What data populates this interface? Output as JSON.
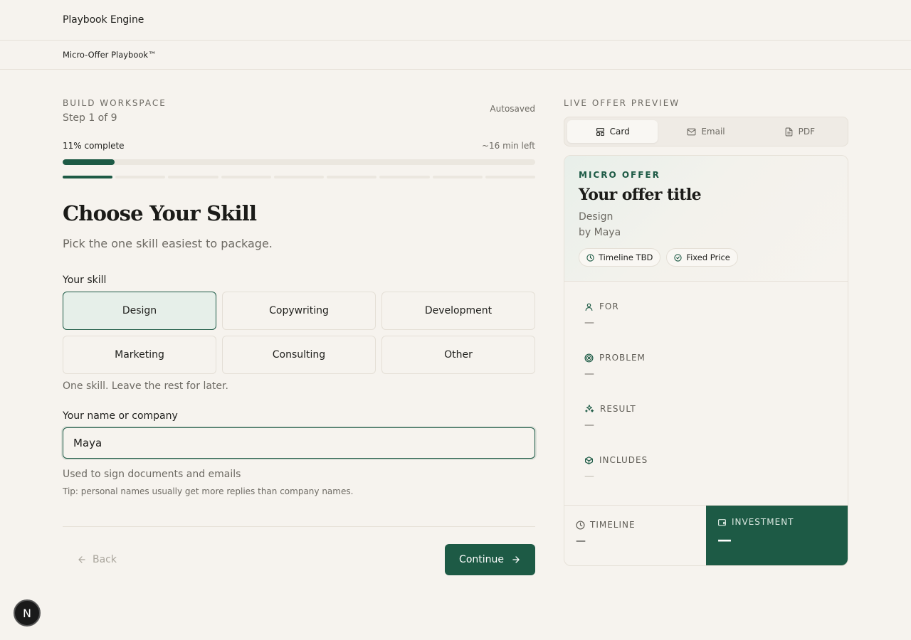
{
  "app": {
    "brand": "Playbook Engine",
    "breadcrumb": "Micro-Offer Playbook™"
  },
  "workspace": {
    "eyebrow": "BUILD WORKSPACE",
    "step": "Step 1 of 9",
    "autosave": "Autosaved",
    "progress_text": "11% complete",
    "time_left": "~16 min left",
    "progress": 0.11,
    "steps_total": 9,
    "steps_done": 1
  },
  "form": {
    "title": "Choose Your Skill",
    "subtitle": "Pick the one skill easiest to package.",
    "skill_label": "Your skill",
    "skills": [
      "Design",
      "Copywriting",
      "Development",
      "Marketing",
      "Consulting",
      "Other"
    ],
    "selected_skill": "Design",
    "skill_hint": "One skill. Leave the rest for later.",
    "name_label": "Your name or company",
    "name_value": "Maya",
    "name_help": "Used to sign documents and emails",
    "name_tip": "Tip: personal names usually get more replies than company names.",
    "back_label": "Back",
    "continue_label": "Continue"
  },
  "preview": {
    "eyebrow": "LIVE OFFER PREVIEW",
    "tabs": [
      {
        "label": "Card",
        "icon": "card-layout-icon"
      },
      {
        "label": "Email",
        "icon": "mail-icon"
      },
      {
        "label": "PDF",
        "icon": "document-icon"
      }
    ],
    "card": {
      "eyebrow": "MICRO OFFER",
      "title": "Your offer title",
      "skill": "Design",
      "byline": "by Maya",
      "chips": [
        "Timeline TBD",
        "Fixed Price"
      ],
      "sections": [
        {
          "label": "FOR",
          "value": "—",
          "icon": "user-icon"
        },
        {
          "label": "PROBLEM",
          "value": "—",
          "icon": "target-icon"
        },
        {
          "label": "RESULT",
          "value": "—",
          "icon": "sparkles-icon"
        },
        {
          "label": "INCLUDES",
          "value": "—",
          "icon": "package-icon"
        }
      ],
      "timeline_label": "TIMELINE",
      "timeline_value": "—",
      "investment_label": "INVESTMENT",
      "investment_value": "—"
    }
  },
  "badge": "N",
  "colors": {
    "accent": "#1d5a45",
    "background": "#f6f3ee",
    "selected_bg": "#e6efe9"
  }
}
